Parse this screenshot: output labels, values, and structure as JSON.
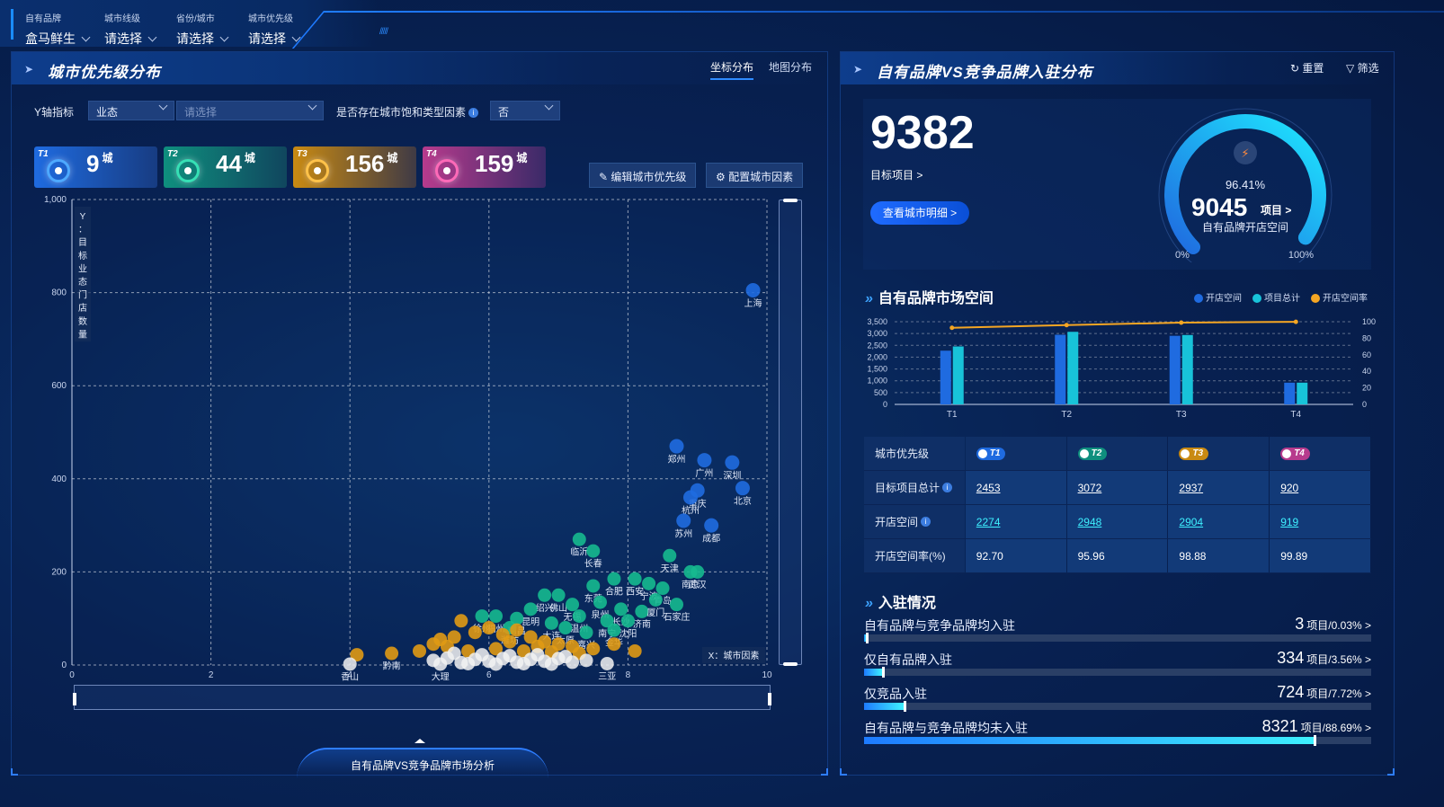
{
  "filters": [
    {
      "label": "自有品牌",
      "value": "盒马鲜生"
    },
    {
      "label": "城市线级",
      "value": "请选择"
    },
    {
      "label": "省份/城市",
      "value": "请选择"
    },
    {
      "label": "城市优先级",
      "value": "请选择"
    }
  ],
  "stripes": "/////",
  "left": {
    "title": "城市优先级分布",
    "tabs": [
      "坐标分布",
      "地图分布"
    ],
    "y_label": "Y轴指标",
    "y_select": "业态",
    "y_select2_placeholder": "请选择",
    "factor_label": "是否存在城市饱和类型因素",
    "factor_value": "否",
    "tiers": [
      {
        "badge": "T1",
        "count": "9",
        "unit": "城",
        "color": "#1f6be0"
      },
      {
        "badge": "T2",
        "count": "44",
        "unit": "城",
        "color": "#0f8f7e"
      },
      {
        "badge": "T3",
        "count": "156",
        "unit": "城",
        "color": "#c98a12"
      },
      {
        "badge": "T4",
        "count": "159",
        "unit": "城",
        "color": "#b73b8d"
      }
    ],
    "btn_edit": "编辑城市优先级",
    "btn_config": "配置城市因素",
    "bottom_tab": "自有品牌VS竞争品牌市场分析"
  },
  "chart_data": [
    {
      "type": "scatter",
      "ylabel": "Y：目标业态门店数量",
      "xlabel": "X：城市因素",
      "xlim": [
        0,
        10
      ],
      "ylim": [
        0,
        1000
      ],
      "x_ticks": [
        "0",
        "2",
        "4",
        "6",
        "8",
        "10"
      ],
      "y_ticks": [
        "0",
        "200",
        "400",
        "600",
        "800",
        "1,000"
      ],
      "grid": true,
      "series": [
        {
          "tier": "T1",
          "color": "#1f6be0",
          "points": [
            {
              "x": 9.8,
              "y": 805,
              "label": "上海"
            },
            {
              "x": 8.7,
              "y": 470,
              "label": "郑州"
            },
            {
              "x": 9.1,
              "y": 440,
              "label": "广州"
            },
            {
              "x": 9.5,
              "y": 435,
              "label": "深圳"
            },
            {
              "x": 9.0,
              "y": 375,
              "label": "重庆"
            },
            {
              "x": 8.9,
              "y": 360,
              "label": "杭州"
            },
            {
              "x": 9.65,
              "y": 380,
              "label": "北京"
            },
            {
              "x": 8.8,
              "y": 310,
              "label": "苏州"
            },
            {
              "x": 9.2,
              "y": 300,
              "label": "成都"
            }
          ]
        },
        {
          "tier": "T2",
          "color": "#16b98f",
          "points": [
            {
              "x": 7.3,
              "y": 270,
              "label": "临沂"
            },
            {
              "x": 7.5,
              "y": 245,
              "label": "长春"
            },
            {
              "x": 8.6,
              "y": 235,
              "label": "天津"
            },
            {
              "x": 8.9,
              "y": 200,
              "label": "南京"
            },
            {
              "x": 9.0,
              "y": 200,
              "label": "武汉"
            },
            {
              "x": 6.8,
              "y": 150,
              "label": "绍兴"
            },
            {
              "x": 7.0,
              "y": 150,
              "label": "佛山"
            },
            {
              "x": 7.5,
              "y": 170,
              "label": "东莞"
            },
            {
              "x": 7.8,
              "y": 185,
              "label": "合肥"
            },
            {
              "x": 8.1,
              "y": 185,
              "label": "西安"
            },
            {
              "x": 8.3,
              "y": 175,
              "label": "宁波"
            },
            {
              "x": 8.5,
              "y": 165,
              "label": "青岛"
            },
            {
              "x": 7.2,
              "y": 130,
              "label": "无锡"
            },
            {
              "x": 7.6,
              "y": 135,
              "label": "泉州"
            },
            {
              "x": 7.9,
              "y": 120,
              "label": "长沙"
            },
            {
              "x": 8.2,
              "y": 115,
              "label": "济南"
            },
            {
              "x": 8.4,
              "y": 140,
              "label": "厦门"
            },
            {
              "x": 6.1,
              "y": 105,
              "label": "福州"
            },
            {
              "x": 5.9,
              "y": 105,
              "label": "徐州"
            },
            {
              "x": 6.6,
              "y": 120,
              "label": "昆明"
            },
            {
              "x": 7.3,
              "y": 105,
              "label": "温州"
            },
            {
              "x": 7.7,
              "y": 95,
              "label": "南宁"
            },
            {
              "x": 8.0,
              "y": 95,
              "label": "沈阳"
            },
            {
              "x": 6.4,
              "y": 100,
              "label": "南昌"
            },
            {
              "x": 8.7,
              "y": 130,
              "label": "石家庄"
            },
            {
              "x": 7.1,
              "y": 80,
              "label": "太原"
            },
            {
              "x": 6.9,
              "y": 90,
              "label": "大连"
            },
            {
              "x": 7.4,
              "y": 70,
              "label": "嘉兴"
            },
            {
              "x": 7.8,
              "y": 75,
              "label": "金华"
            },
            {
              "x": 6.3,
              "y": 80,
              "label": "潍坊"
            }
          ]
        },
        {
          "tier": "T3",
          "color": "#e09a14",
          "points": [
            {
              "x": 4.1,
              "y": 22,
              "label": ""
            },
            {
              "x": 4.6,
              "y": 25,
              "label": "黔南"
            },
            {
              "x": 5.0,
              "y": 30,
              "label": ""
            },
            {
              "x": 5.2,
              "y": 45,
              "label": ""
            },
            {
              "x": 5.5,
              "y": 60,
              "label": ""
            },
            {
              "x": 5.6,
              "y": 95,
              "label": ""
            },
            {
              "x": 5.8,
              "y": 70,
              "label": ""
            },
            {
              "x": 6.0,
              "y": 80,
              "label": ""
            },
            {
              "x": 6.2,
              "y": 65,
              "label": ""
            },
            {
              "x": 6.4,
              "y": 75,
              "label": ""
            },
            {
              "x": 6.6,
              "y": 60,
              "label": ""
            },
            {
              "x": 6.8,
              "y": 50,
              "label": ""
            },
            {
              "x": 7.0,
              "y": 45,
              "label": ""
            },
            {
              "x": 7.2,
              "y": 40,
              "label": ""
            },
            {
              "x": 7.5,
              "y": 35,
              "label": ""
            },
            {
              "x": 7.8,
              "y": 45,
              "label": ""
            },
            {
              "x": 8.1,
              "y": 30,
              "label": ""
            },
            {
              "x": 5.4,
              "y": 40,
              "label": ""
            },
            {
              "x": 5.7,
              "y": 30,
              "label": ""
            },
            {
              "x": 6.1,
              "y": 35,
              "label": ""
            },
            {
              "x": 6.5,
              "y": 30,
              "label": ""
            },
            {
              "x": 6.9,
              "y": 28,
              "label": ""
            },
            {
              "x": 7.3,
              "y": 25,
              "label": ""
            },
            {
              "x": 5.3,
              "y": 55,
              "label": ""
            },
            {
              "x": 6.3,
              "y": 50,
              "label": ""
            },
            {
              "x": 6.7,
              "y": 40,
              "label": ""
            }
          ]
        },
        {
          "tier": "T4",
          "color": "#f2f2f2",
          "points": [
            {
              "x": 5.2,
              "y": 10,
              "label": ""
            },
            {
              "x": 5.4,
              "y": 15,
              "label": ""
            },
            {
              "x": 5.6,
              "y": 5,
              "label": ""
            },
            {
              "x": 5.8,
              "y": 12,
              "label": ""
            },
            {
              "x": 6.0,
              "y": 8,
              "label": ""
            },
            {
              "x": 6.2,
              "y": 14,
              "label": ""
            },
            {
              "x": 6.4,
              "y": 6,
              "label": ""
            },
            {
              "x": 6.6,
              "y": 12,
              "label": ""
            },
            {
              "x": 6.8,
              "y": 8,
              "label": ""
            },
            {
              "x": 7.0,
              "y": 14,
              "label": ""
            },
            {
              "x": 7.2,
              "y": 6,
              "label": ""
            },
            {
              "x": 7.4,
              "y": 10,
              "label": ""
            },
            {
              "x": 5.5,
              "y": 25,
              "label": ""
            },
            {
              "x": 5.9,
              "y": 22,
              "label": ""
            },
            {
              "x": 6.3,
              "y": 20,
              "label": ""
            },
            {
              "x": 6.7,
              "y": 22,
              "label": ""
            },
            {
              "x": 7.1,
              "y": 18,
              "label": ""
            },
            {
              "x": 5.7,
              "y": 3,
              "label": ""
            },
            {
              "x": 6.1,
              "y": 2,
              "label": ""
            },
            {
              "x": 6.5,
              "y": 3,
              "label": ""
            },
            {
              "x": 6.9,
              "y": 2,
              "label": ""
            },
            {
              "x": 4.0,
              "y": 2,
              "label": "香山"
            },
            {
              "x": 5.3,
              "y": 2,
              "label": "大理"
            },
            {
              "x": 7.7,
              "y": 3,
              "label": "三亚"
            }
          ]
        }
      ]
    },
    {
      "type": "bar",
      "title": "自有品牌市场空间",
      "categories": [
        "T1",
        "T2",
        "T3",
        "T4"
      ],
      "ylim": [
        0,
        3500
      ],
      "y_ticks": [
        "0",
        "500",
        "1,000",
        "1,500",
        "2,000",
        "2,500",
        "3,000",
        "3,500"
      ],
      "y2lim": [
        0,
        100
      ],
      "y2_ticks": [
        "0",
        "20",
        "40",
        "60",
        "80",
        "100"
      ],
      "series": [
        {
          "name": "开店空间",
          "color": "#1f6be0",
          "values": [
            2274,
            2948,
            2904,
            919
          ]
        },
        {
          "name": "项目总计",
          "color": "#18c3d9",
          "values": [
            2453,
            3072,
            2937,
            920
          ]
        },
        {
          "name": "开店空间率",
          "color": "#f5a623",
          "type": "line",
          "axis": "right",
          "values": [
            92.7,
            95.96,
            98.88,
            99.89
          ]
        }
      ]
    }
  ],
  "right": {
    "title": "自有品牌VS竞争品牌入驻分布",
    "reset": "重置",
    "filter": "筛选",
    "target_count": "9382",
    "target_label": "目标项目 >",
    "view_btn": "查看城市明细 >",
    "gauge": {
      "percent": "96.41%",
      "percent_value": 96.41,
      "value": "9045",
      "unit": "项目 >",
      "label": "自有品牌开店空间",
      "min_label": "0%",
      "max_label": "100%"
    },
    "market_title": "自有品牌市场空间",
    "table": {
      "headers": [
        "城市优先级",
        "T1",
        "T2",
        "T3",
        "T4"
      ],
      "chip_colors": [
        "#1f6be0",
        "#0f8f7e",
        "#c98a12",
        "#b73b8d"
      ],
      "rows": [
        {
          "label": "目标项目总计",
          "info": true,
          "values": [
            "2453",
            "3072",
            "2937",
            "920"
          ],
          "link": "white"
        },
        {
          "label": "开店空间",
          "info": true,
          "values": [
            "2274",
            "2948",
            "2904",
            "919"
          ],
          "link": "cyan"
        },
        {
          "label": "开店空间率(%)",
          "info": false,
          "values": [
            "92.70",
            "95.96",
            "98.88",
            "99.89"
          ],
          "link": "none"
        }
      ]
    },
    "entry_title": "入驻情况",
    "entries": [
      {
        "label": "自有品牌与竞争品牌均入驻",
        "count": "3",
        "suffix": "项目/0.03% >",
        "percent": 0.03
      },
      {
        "label": "仅自有品牌入驻",
        "count": "334",
        "suffix": "项目/3.56% >",
        "percent": 3.56
      },
      {
        "label": "仅竞品入驻",
        "count": "724",
        "suffix": "项目/7.72% >",
        "percent": 7.72
      },
      {
        "label": "自有品牌与竞争品牌均未入驻",
        "count": "8321",
        "suffix": "项目/88.69% >",
        "percent": 88.69
      }
    ]
  }
}
